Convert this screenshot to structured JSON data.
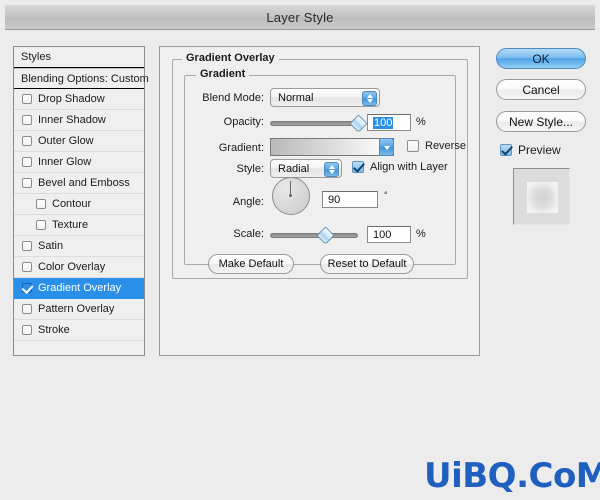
{
  "window": {
    "title": "Layer Style"
  },
  "styles_panel": {
    "header_label": "Styles",
    "blending_label": "Blending Options: Custom",
    "items": [
      {
        "label": "Drop Shadow",
        "checked": false,
        "indent": false,
        "selected": false
      },
      {
        "label": "Inner Shadow",
        "checked": false,
        "indent": false,
        "selected": false
      },
      {
        "label": "Outer Glow",
        "checked": false,
        "indent": false,
        "selected": false
      },
      {
        "label": "Inner Glow",
        "checked": false,
        "indent": false,
        "selected": false
      },
      {
        "label": "Bevel and Emboss",
        "checked": false,
        "indent": false,
        "selected": false
      },
      {
        "label": "Contour",
        "checked": false,
        "indent": true,
        "selected": false
      },
      {
        "label": "Texture",
        "checked": false,
        "indent": true,
        "selected": false
      },
      {
        "label": "Satin",
        "checked": false,
        "indent": false,
        "selected": false
      },
      {
        "label": "Color Overlay",
        "checked": false,
        "indent": false,
        "selected": false
      },
      {
        "label": "Gradient Overlay",
        "checked": true,
        "indent": false,
        "selected": true
      },
      {
        "label": "Pattern Overlay",
        "checked": false,
        "indent": false,
        "selected": false
      },
      {
        "label": "Stroke",
        "checked": false,
        "indent": false,
        "selected": false
      }
    ]
  },
  "main_panel": {
    "group_title": "Gradient Overlay",
    "subgroup_title": "Gradient",
    "blend_mode": {
      "label": "Blend Mode:",
      "value": "Normal"
    },
    "opacity": {
      "label": "Opacity:",
      "value": "100",
      "unit": "%",
      "slider_percent": 100
    },
    "gradient": {
      "label": "Gradient:",
      "reverse_label": "Reverse",
      "reverse_checked": false
    },
    "style": {
      "label": "Style:",
      "value": "Radial",
      "align_label": "Align with Layer",
      "align_checked": true
    },
    "angle": {
      "label": "Angle:",
      "value": "90",
      "unit": "°"
    },
    "scale": {
      "label": "Scale:",
      "value": "100",
      "unit": "%",
      "slider_percent": 62
    },
    "make_default_label": "Make Default",
    "reset_default_label": "Reset to Default"
  },
  "buttons": {
    "ok": "OK",
    "cancel": "Cancel",
    "new_style": "New Style...",
    "preview_label": "Preview",
    "preview_checked": true
  },
  "watermark": {
    "text": "UiBQ.CoM",
    "color": "#1f5fbf"
  },
  "colors": {
    "accent": "#2a8fe8",
    "dialog_bg": "#ececec",
    "panel_bg": "#efefef"
  }
}
